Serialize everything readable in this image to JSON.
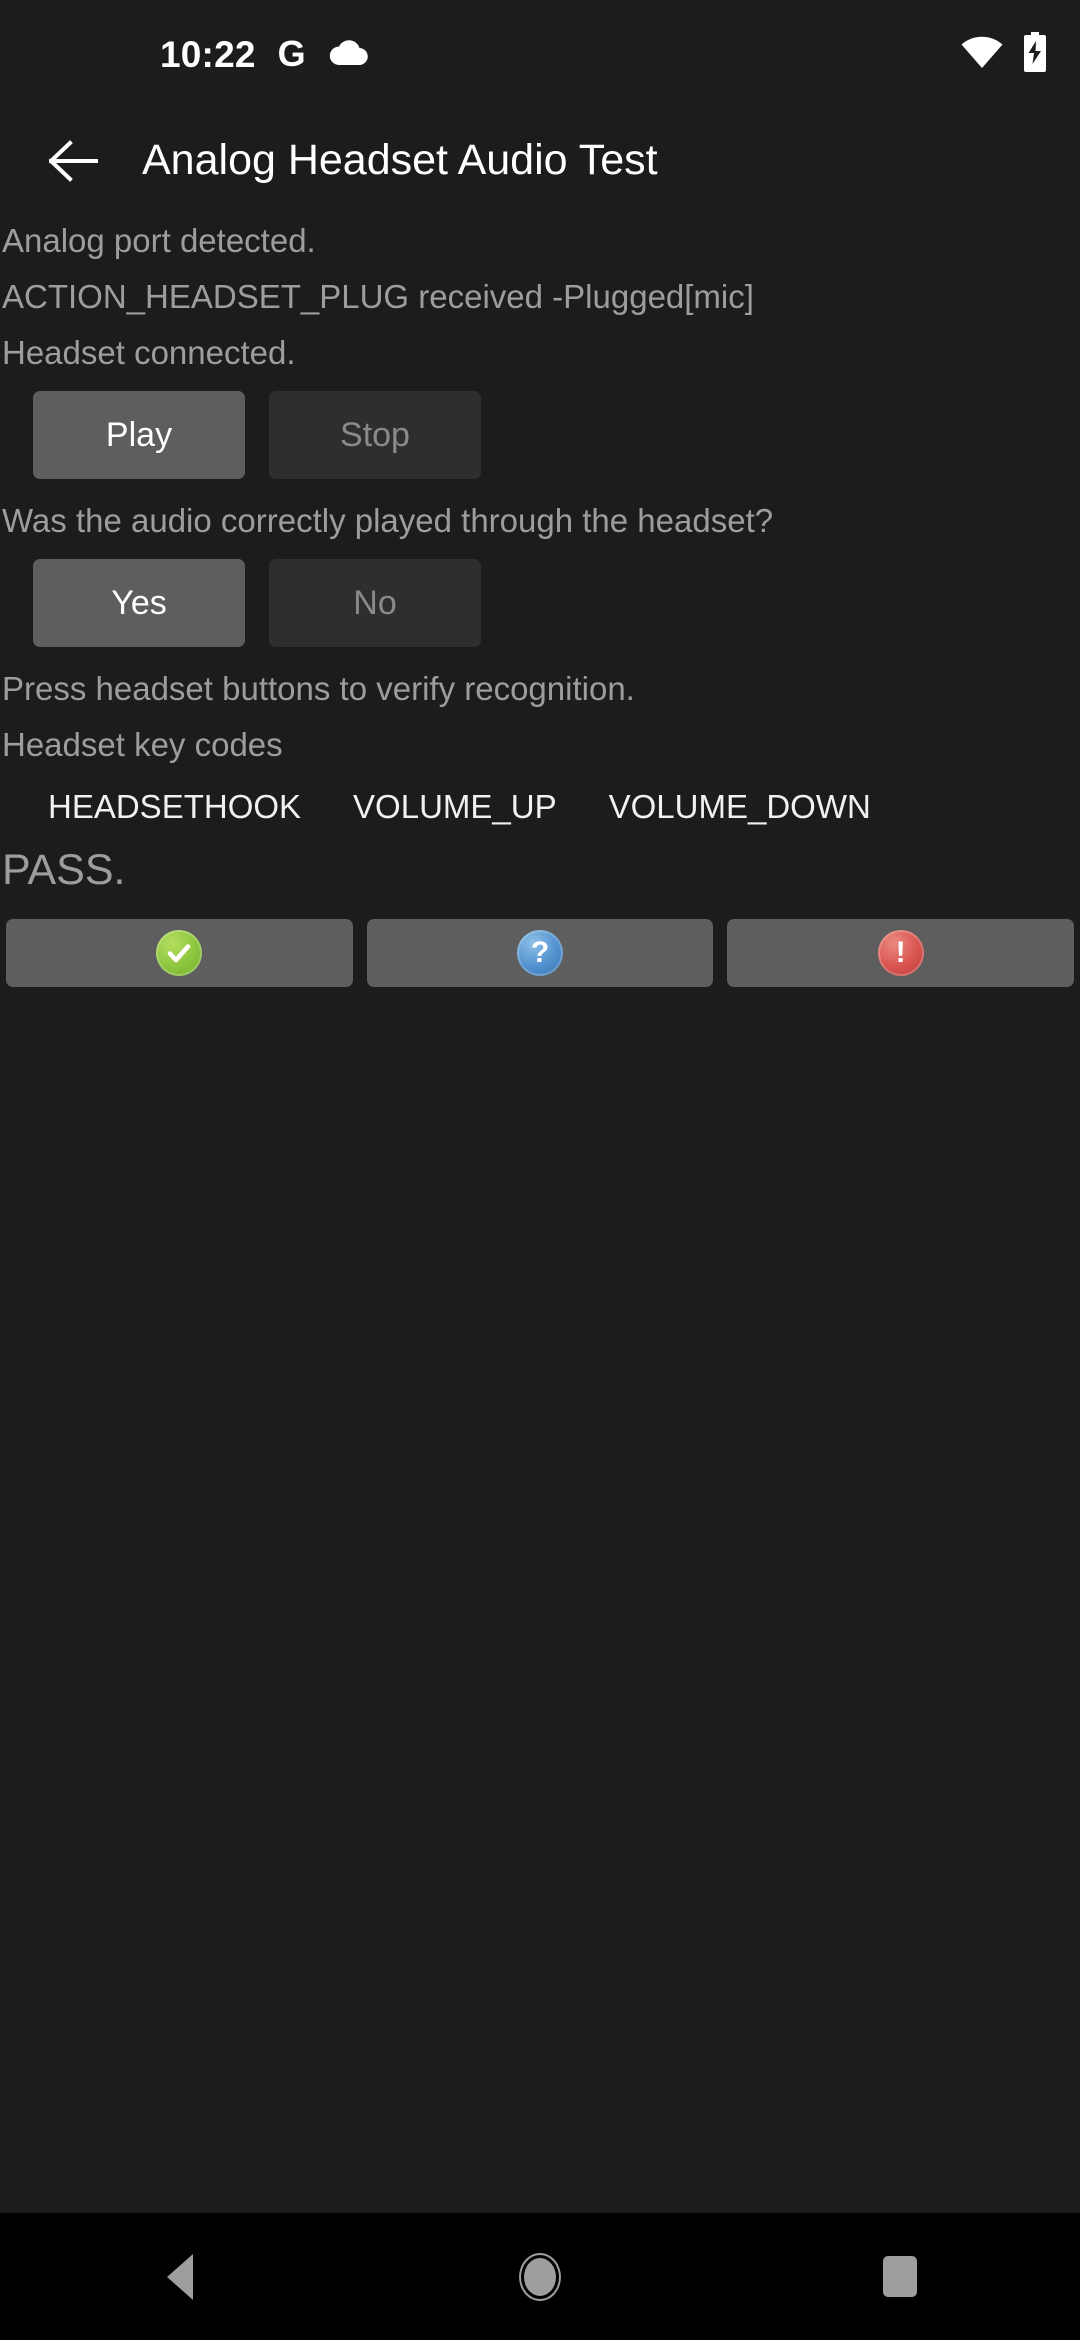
{
  "status_bar": {
    "clock": "10:22",
    "left_icons": [
      {
        "name": "google-g-icon",
        "glyph": "G"
      },
      {
        "name": "cloud-icon",
        "glyph": "cloud"
      }
    ],
    "right_icons": [
      {
        "name": "wifi-icon",
        "label": "wifi-full"
      },
      {
        "name": "battery-charging-icon",
        "label": "battery-charging"
      }
    ]
  },
  "app_bar": {
    "back_label": "back-arrow",
    "title": "Analog Headset Audio Test"
  },
  "content": {
    "status_lines": [
      "Analog port detected.",
      "ACTION_HEADSET_PLUG received -Plugged[mic]",
      "Headset connected."
    ],
    "playback": {
      "play_label": "Play",
      "stop_label": "Stop"
    },
    "question": "Was the audio correctly played through the headset?",
    "answers": {
      "yes_label": "Yes",
      "no_label": "No"
    },
    "press_instruction": "Press headset buttons to verify recognition.",
    "keycodes_label": "Headset key codes",
    "keycodes": [
      "HEADSETHOOK",
      "VOLUME_UP",
      "VOLUME_DOWN"
    ],
    "verdict": "PASS."
  },
  "actions": [
    {
      "name": "pass-button",
      "icon": "check-icon",
      "glyph": "✔",
      "color": "#8cc63e"
    },
    {
      "name": "info-button",
      "icon": "question-icon",
      "glyph": "?",
      "color": "#4f90cd"
    },
    {
      "name": "fail-button",
      "icon": "exclamation-icon",
      "glyph": "!",
      "color": "#d9534f"
    }
  ],
  "nav_bar": {
    "back": "back-nav",
    "home": "home-nav",
    "recents": "recents-nav"
  },
  "colors": {
    "background": "#1b1c1d",
    "nav_background": "#000000",
    "text_primary": "#ffffff",
    "text_secondary": "#9d9d9d",
    "button_enabled": "#5e5e5e",
    "button_disabled": "#2e2e2e"
  }
}
